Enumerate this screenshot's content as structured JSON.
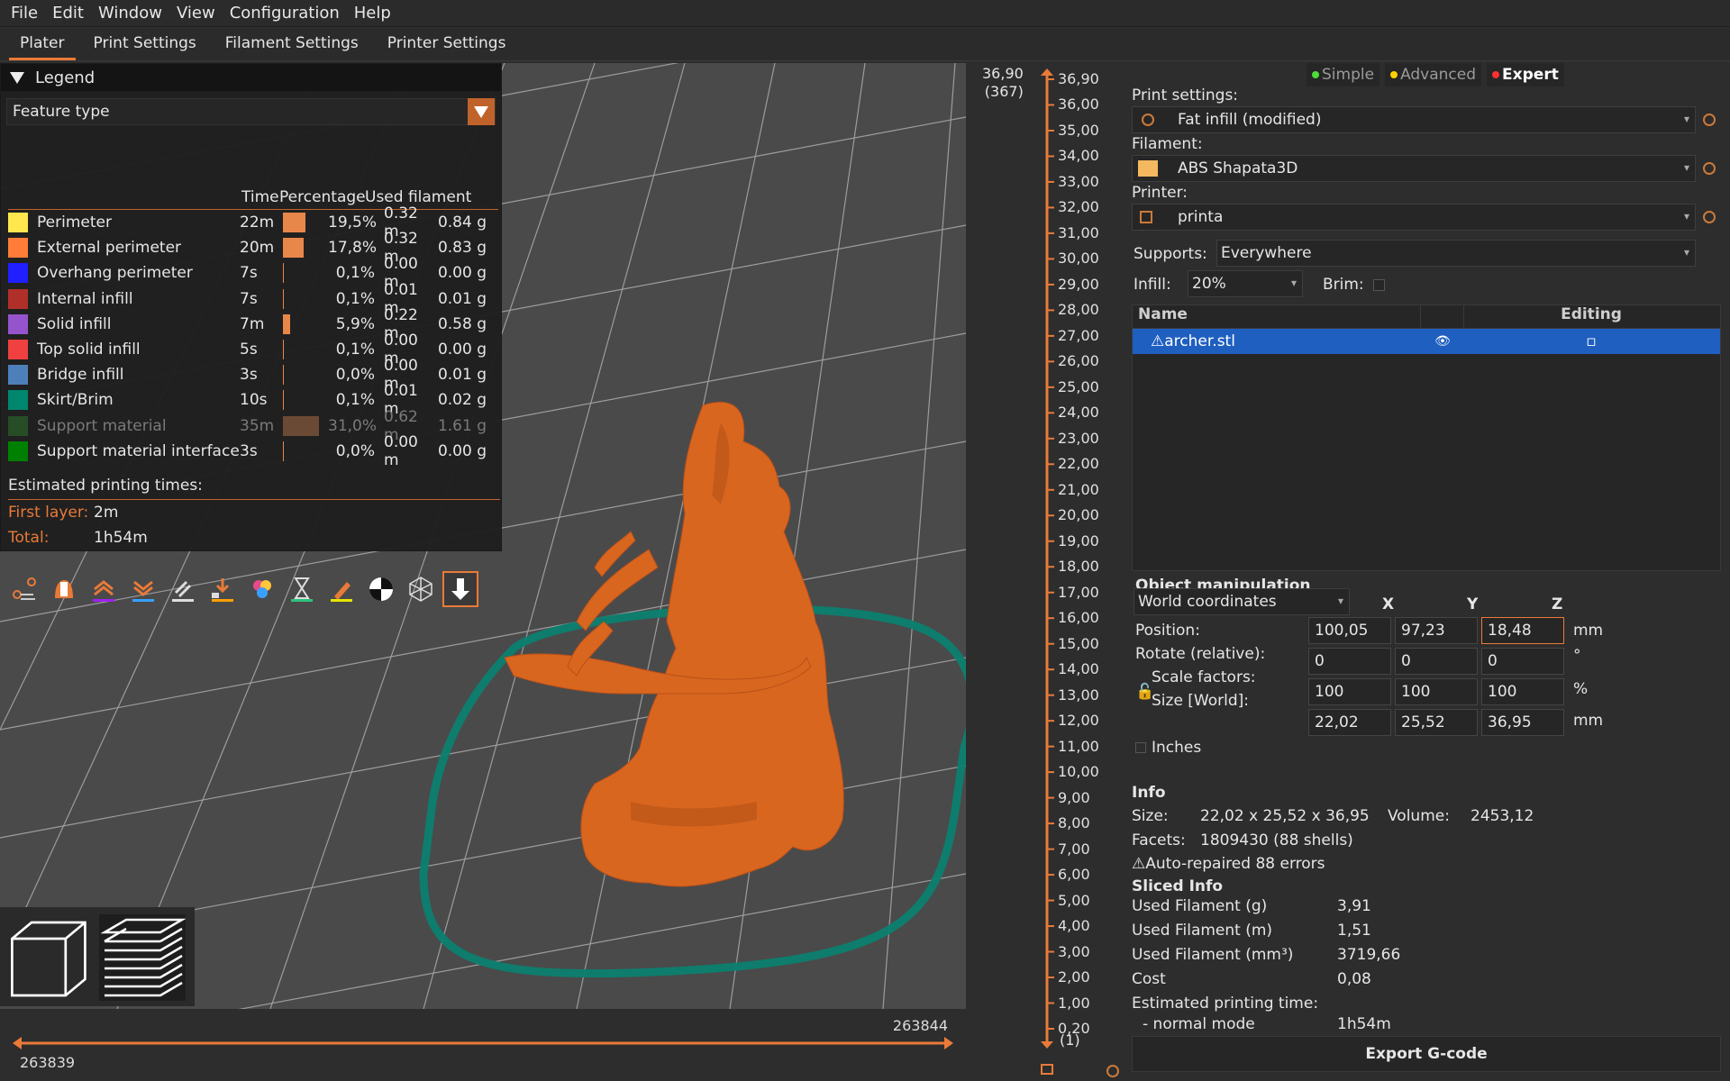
{
  "menu": [
    "File",
    "Edit",
    "Window",
    "View",
    "Configuration",
    "Help"
  ],
  "tabs": [
    "Plater",
    "Print Settings",
    "Filament Settings",
    "Printer Settings"
  ],
  "legend": {
    "title": "Legend",
    "view_type": "Feature type",
    "headers": {
      "time": "Time",
      "percentage": "Percentage",
      "used": "Used filament"
    },
    "rows": [
      {
        "name": "Perimeter",
        "color": "#ffe74d",
        "time": "22m",
        "fraction": 0.195,
        "pct": "19,5%",
        "m": "0.32 m",
        "g": "0.84 g"
      },
      {
        "name": "External perimeter",
        "color": "#ff7d38",
        "time": "20m",
        "fraction": 0.178,
        "pct": "17,8%",
        "m": "0.32 m",
        "g": "0.83 g"
      },
      {
        "name": "Overhang perimeter",
        "color": "#1f1fff",
        "time": "7s",
        "fraction": 0.001,
        "pct": "0,1%",
        "m": "0.00 m",
        "g": "0.00 g"
      },
      {
        "name": "Internal infill",
        "color": "#b03029",
        "time": "7s",
        "fraction": 0.001,
        "pct": "0,1%",
        "m": "0.01 m",
        "g": "0.01 g"
      },
      {
        "name": "Solid infill",
        "color": "#9654cc",
        "time": "7m",
        "fraction": 0.059,
        "pct": "5,9%",
        "m": "0.22 m",
        "g": "0.58 g"
      },
      {
        "name": "Top solid infill",
        "color": "#f04040",
        "time": "5s",
        "fraction": 0.001,
        "pct": "0,1%",
        "m": "0.00 m",
        "g": "0.00 g"
      },
      {
        "name": "Bridge infill",
        "color": "#4d80ba",
        "time": "3s",
        "fraction": 0.0,
        "pct": "0,0%",
        "m": "0.00 m",
        "g": "0.01 g"
      },
      {
        "name": "Skirt/Brim",
        "color": "#00876e",
        "time": "10s",
        "fraction": 0.001,
        "pct": "0,1%",
        "m": "0.01 m",
        "g": "0.02 g"
      },
      {
        "name": "Support material",
        "color": "#2e7a2e",
        "time": "35m",
        "fraction": 0.31,
        "pct": "31,0%",
        "m": "0.62 m",
        "g": "1.61 g",
        "dim": true
      },
      {
        "name": "Support material interface",
        "color": "#008000",
        "time": "3s",
        "fraction": 0.0,
        "pct": "0,0%",
        "m": "0.00 m",
        "g": "0.00 g"
      }
    ],
    "times_title": "Estimated printing times:",
    "first_layer_label": "First layer:",
    "first_layer": "2m",
    "total_label": "Total:",
    "total": "1h54m",
    "icons": [
      "travel-icon",
      "wipe-icon",
      "retraction-icon",
      "deretraction-icon",
      "seams-icon",
      "tool-change-icon",
      "color-change-icon",
      "pause-icon",
      "custom-gcode-icon",
      "center-of-gravity-icon",
      "shells-icon",
      "tool-marker-icon"
    ]
  },
  "slider_h": {
    "top": "263844",
    "bottom": "263839"
  },
  "slider_v": {
    "top_value": "36,90",
    "top_layer": "(367)",
    "bottom_value": "0,20",
    "bottom_layer": "(1)",
    "ticks": [
      "36,90",
      "36,00",
      "35,00",
      "34,00",
      "33,00",
      "32,00",
      "31,00",
      "30,00",
      "29,00",
      "28,00",
      "27,00",
      "26,00",
      "25,00",
      "24,00",
      "23,00",
      "22,00",
      "21,00",
      "20,00",
      "19,00",
      "18,00",
      "17,00",
      "16,00",
      "15,00",
      "14,00",
      "13,00",
      "12,00",
      "11,00",
      "10,00",
      "9,00",
      "8,00",
      "7,00",
      "6,00",
      "5,00",
      "4,00",
      "3,00",
      "2,00",
      "1,00",
      "0,20"
    ]
  },
  "mode": {
    "simple": "Simple",
    "advanced": "Advanced",
    "expert": "Expert"
  },
  "presets": {
    "print_label": "Print settings:",
    "print_value": "Fat infill (modified)",
    "filament_label": "Filament:",
    "filament_value": "ABS Shapata3D",
    "printer_label": "Printer:",
    "printer_value": "printa",
    "supports_label": "Supports:",
    "supports_value": "Everywhere",
    "infill_label": "Infill:",
    "infill_value": "20%",
    "brim_label": "Brim:"
  },
  "objects": {
    "col_name": "Name",
    "col_editing": "Editing",
    "rows": [
      {
        "name": "archer.stl"
      }
    ]
  },
  "manip": {
    "title": "Object manipulation",
    "coords": "World coordinates",
    "x": "X",
    "y": "Y",
    "z": "Z",
    "position_label": "Position:",
    "position": [
      "100,05",
      "97,23",
      "18,48"
    ],
    "position_unit": "mm",
    "rotate_label": "Rotate (relative):",
    "rotate": [
      "0",
      "0",
      "0"
    ],
    "rotate_unit": "°",
    "scale_label": "Scale factors:",
    "scale": [
      "100",
      "100",
      "100"
    ],
    "scale_unit": "%",
    "size_label": "Size [World]:",
    "size": [
      "22,02",
      "25,52",
      "36,95"
    ],
    "size_unit": "mm",
    "inches_label": "Inches"
  },
  "info": {
    "title": "Info",
    "size_label": "Size:",
    "size": "22,02 x 25,52 x 36,95",
    "volume_label": "Volume:",
    "volume": "2453,12",
    "facets_label": "Facets:",
    "facets": "1809430 (88 shells)",
    "repaired": "Auto-repaired 88 errors"
  },
  "sliced": {
    "title": "Sliced Info",
    "rows": [
      {
        "label": "Used Filament (g)",
        "value": "3,91"
      },
      {
        "label": "Used Filament (m)",
        "value": "1,51"
      },
      {
        "label": "Used Filament (mm³)",
        "value": "3719,66"
      },
      {
        "label": "Cost",
        "value": "0,08"
      }
    ],
    "est_label": "Estimated printing time:",
    "mode_label": "- normal mode",
    "mode_value": "1h54m"
  },
  "export_label": "Export G-code",
  "colors": {
    "accent": "#ea7a38",
    "model": "#d9661f",
    "skirt": "#0b7f6f",
    "selection": "#1f5fc0"
  }
}
